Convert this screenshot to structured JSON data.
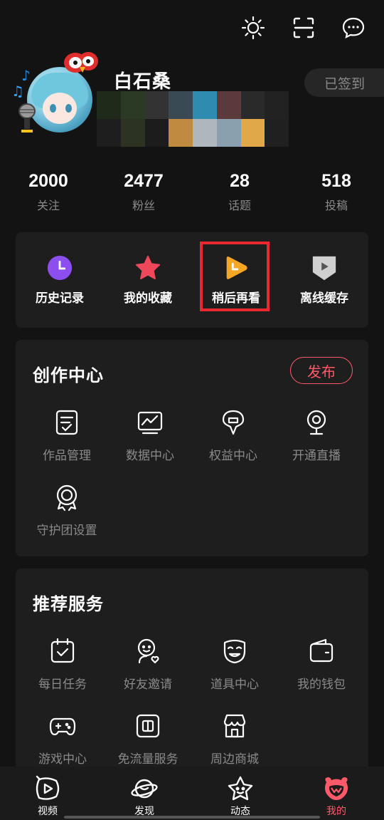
{
  "header": {
    "icons": [
      "brightness-icon",
      "scan-icon",
      "message-icon"
    ]
  },
  "profile": {
    "username": "白石桑",
    "checkin_label": "已签到"
  },
  "stats": [
    {
      "value": "2000",
      "label": "关注"
    },
    {
      "value": "2477",
      "label": "粉丝"
    },
    {
      "value": "28",
      "label": "话题"
    },
    {
      "value": "518",
      "label": "投稿"
    }
  ],
  "quick_actions": [
    {
      "label": "历史记录",
      "icon": "history-clock-icon",
      "color": "#8d4ef0"
    },
    {
      "label": "我的收藏",
      "icon": "star-icon",
      "color": "#f0485a"
    },
    {
      "label": "稍后再看",
      "icon": "watch-later-icon",
      "color": "#f5a623",
      "highlighted": true
    },
    {
      "label": "离线缓存",
      "icon": "offline-download-icon",
      "color": "#cfcfcf"
    }
  ],
  "creation_center": {
    "title": "创作中心",
    "publish_label": "发布",
    "items": [
      {
        "label": "作品管理",
        "icon": "works-manage-icon"
      },
      {
        "label": "数据中心",
        "icon": "data-center-icon"
      },
      {
        "label": "权益中心",
        "icon": "rights-center-icon"
      },
      {
        "label": "开通直播",
        "icon": "live-camera-icon"
      },
      {
        "label": "守护团设置",
        "icon": "guard-medal-icon"
      }
    ]
  },
  "recommended_services": {
    "title": "推荐服务",
    "items": [
      {
        "label": "每日任务",
        "icon": "daily-task-icon"
      },
      {
        "label": "好友邀请",
        "icon": "invite-friend-icon"
      },
      {
        "label": "道具中心",
        "icon": "props-mask-icon"
      },
      {
        "label": "我的钱包",
        "icon": "wallet-icon"
      },
      {
        "label": "游戏中心",
        "icon": "gamepad-icon"
      },
      {
        "label": "免流量服务",
        "icon": "sim-card-icon"
      },
      {
        "label": "周边商城",
        "icon": "store-icon"
      }
    ]
  },
  "tabbar": [
    {
      "label": "视频",
      "icon": "video-tab-icon"
    },
    {
      "label": "发现",
      "icon": "discover-planet-icon"
    },
    {
      "label": "动态",
      "icon": "dynamic-star-icon"
    },
    {
      "label": "我的",
      "icon": "mine-tab-icon",
      "active": true
    }
  ],
  "colors": {
    "accent": "#ff5a6a",
    "highlight_box": "#e8292f",
    "background": "#131313",
    "card": "#1e1e1e"
  }
}
